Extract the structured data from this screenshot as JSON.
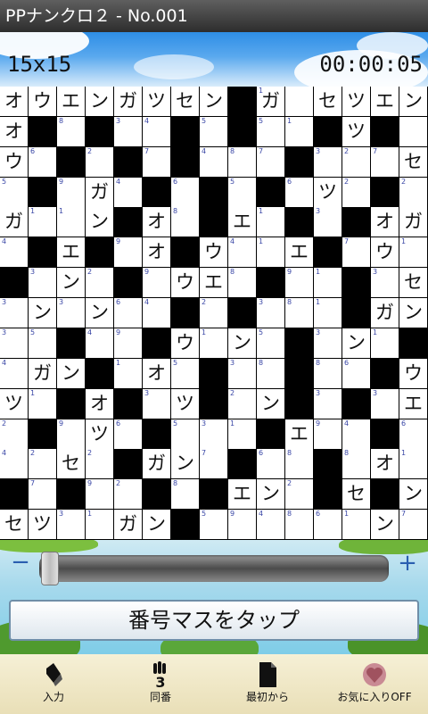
{
  "app": {
    "title": "PPナンクロ２ - No.001"
  },
  "header": {
    "size": "15x15",
    "timer": "00:00:05"
  },
  "grid": {
    "cells": [
      "オ",
      "ウ",
      "エ",
      "ン",
      "ガ",
      "ツ",
      "セ",
      "ン",
      "#",
      "ガ|1",
      "",
      "セ",
      "ツ",
      "エ",
      "ン",
      "オ",
      "#",
      "|8",
      "#",
      "|3",
      "|4",
      "#",
      "|5",
      "#",
      "|5",
      "|1",
      "#",
      "ツ",
      "#",
      "",
      "ウ",
      "|6",
      "#",
      "|2",
      "#",
      "|7",
      "#",
      "|4",
      "|8",
      "|7",
      "#",
      "|3",
      "|2",
      "|7",
      "セ",
      "|5",
      "#",
      "|9",
      "ガ",
      "|4",
      "#",
      "|6",
      "#",
      "|5",
      "#",
      "|6",
      "ツ",
      "|2",
      "#",
      "|2",
      "ガ",
      "|1",
      "|1",
      "ン",
      "#",
      "オ",
      "|8",
      "#",
      "エ",
      "|1",
      "#",
      "|3",
      "#",
      "オ",
      "ガ",
      "|4",
      "#",
      "エ",
      "#",
      "|9",
      "オ",
      "#",
      "ウ",
      "|4",
      "|1",
      "エ",
      "#",
      "|7",
      "ウ",
      "|1",
      "#",
      "|3",
      "ン",
      "|2",
      "#",
      "|9",
      "ウ",
      "エ",
      "|8",
      "#",
      "|9",
      "|1",
      "#",
      "|3",
      "セ",
      "|3",
      "ン",
      "|3",
      "ン",
      "|6",
      "|4",
      "#",
      "|2",
      "#",
      "|3",
      "|8",
      "|1",
      "#",
      "ガ",
      "ン",
      "|3",
      "|5",
      "#",
      "|4",
      "|9",
      "#",
      "ウ",
      "|1",
      "ン",
      "|5",
      "#",
      "|3",
      "ン",
      "|1",
      "#",
      "|4",
      "ガ",
      "ン",
      "#",
      "|1",
      "オ",
      "|5",
      "#",
      "|3",
      "|8",
      "#",
      "|8",
      "|6",
      "#",
      "ウ",
      "ツ",
      "|1",
      "#",
      "オ",
      "#",
      "|3",
      "ツ",
      "#",
      "|2",
      "ン",
      "#",
      "|3",
      "#",
      "|3",
      "エ",
      "|2",
      "#",
      "|9",
      "ツ",
      "|6",
      "#",
      "|5",
      "|3",
      "|1",
      "#",
      "エ",
      "|9",
      "|4",
      "#",
      "|6",
      "|4",
      "|2",
      "セ",
      "|2",
      "#",
      "ガ",
      "ン",
      "|7",
      "#",
      "|6",
      "|8",
      "#",
      "|8",
      "オ",
      "|1",
      "#",
      "|7",
      "#",
      "|9",
      "|2",
      "#",
      "|8",
      "#",
      "エ",
      "ン",
      "|2",
      "#",
      "セ",
      "#",
      "ン",
      "セ",
      "ツ",
      "|3",
      "|1",
      "ガ",
      "ン",
      "#",
      "|5",
      "|9",
      "|4",
      "|8",
      "|6",
      "|1",
      "ン",
      "|7"
    ]
  },
  "slider": {
    "minus": "−",
    "plus": "+",
    "value_fraction": 0.02
  },
  "tap_button": {
    "label": "番号マスをタップ"
  },
  "toolbar": {
    "items": [
      {
        "label": "入力",
        "icon": "pencil-icon"
      },
      {
        "label": "同番",
        "icon": "hand-three-icon"
      },
      {
        "label": "最初から",
        "icon": "document-icon"
      },
      {
        "label": "お気に入りOFF",
        "icon": "heart-icon"
      }
    ]
  }
}
